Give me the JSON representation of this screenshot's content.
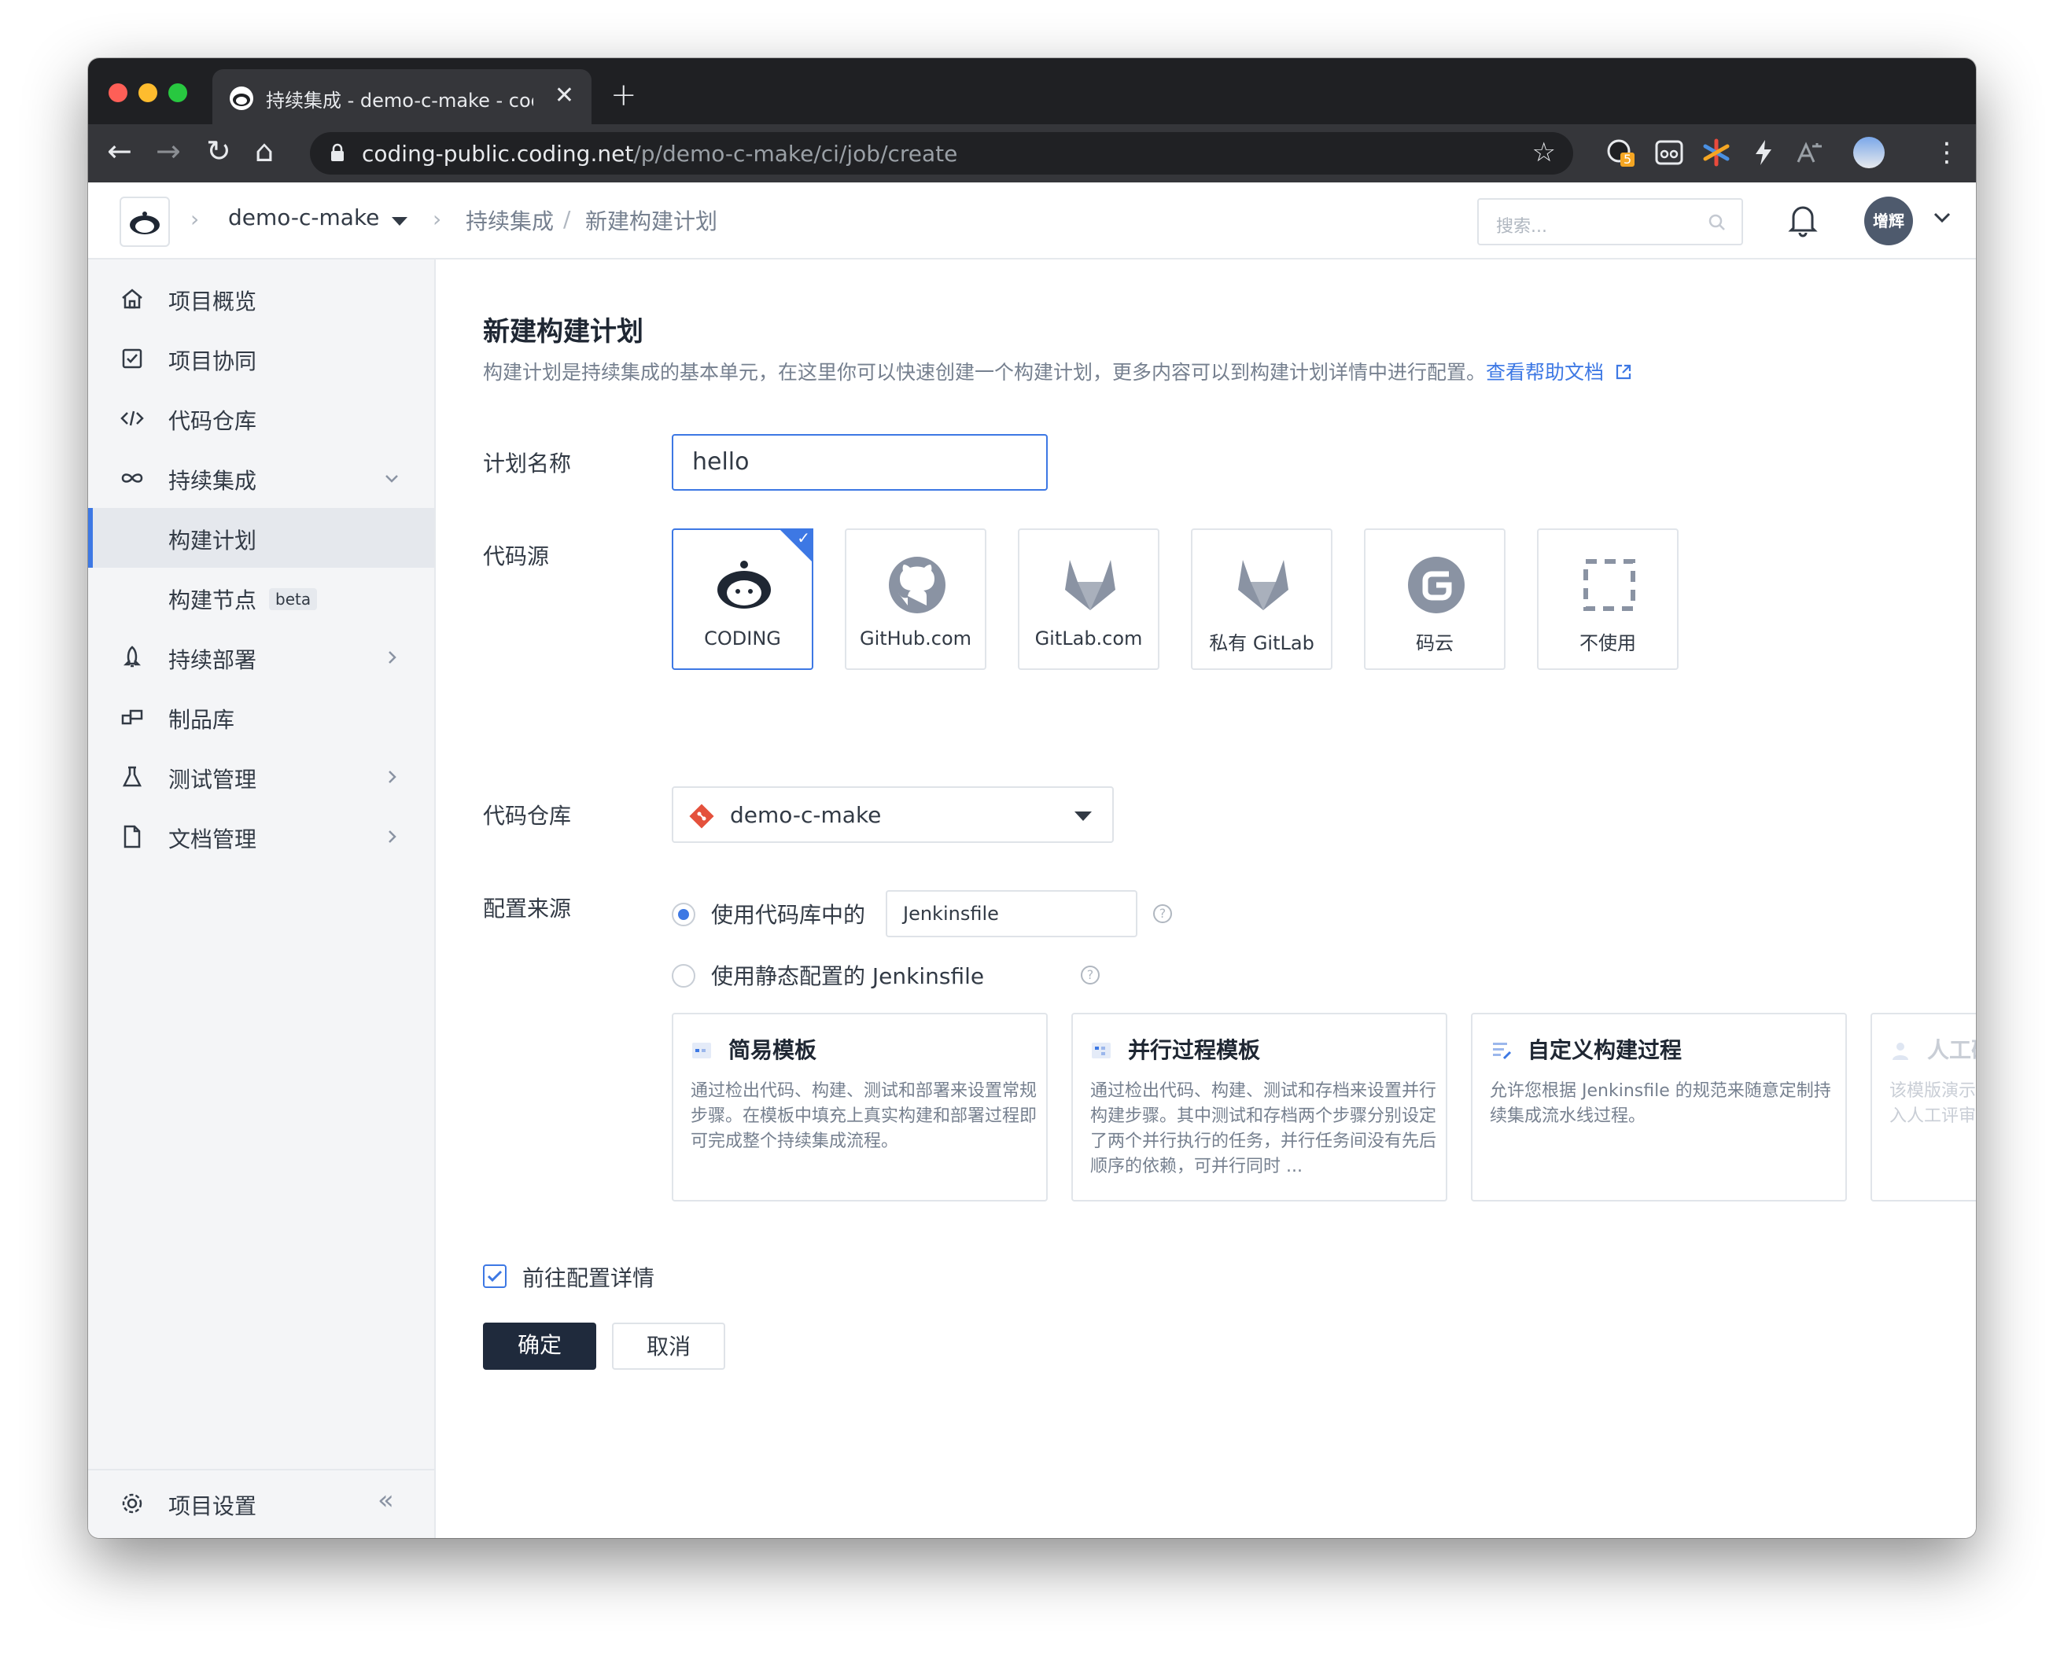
{
  "browser": {
    "tab_title": "持续集成 - demo-c-make - coding",
    "url_host": "coding-public.coding.net",
    "url_path": "/p/demo-c-make/ci/job/create",
    "extension_badge": "5"
  },
  "header": {
    "project": "demo-c-make",
    "breadcrumb_section": "持续集成",
    "breadcrumb_page": "新建构建计划",
    "search_placeholder": "搜索...",
    "avatar_text": "增辉"
  },
  "sidebar": {
    "items": [
      {
        "label": "项目概览",
        "icon": "home-icon"
      },
      {
        "label": "项目协同",
        "icon": "checkbox-icon"
      },
      {
        "label": "代码仓库",
        "icon": "code-icon"
      },
      {
        "label": "持续集成",
        "icon": "infinity-icon"
      },
      {
        "label": "构建计划"
      },
      {
        "label": "构建节点",
        "badge": "beta"
      },
      {
        "label": "持续部署",
        "icon": "rocket-icon"
      },
      {
        "label": "制品库",
        "icon": "package-icon"
      },
      {
        "label": "测试管理",
        "icon": "flask-icon"
      },
      {
        "label": "文档管理",
        "icon": "document-icon"
      }
    ],
    "footer_label": "项目设置"
  },
  "page": {
    "title": "新建构建计划",
    "description": "构建计划是持续集成的基本单元，在这里你可以快速创建一个构建计划，更多内容可以到构建计划详情中进行配置。",
    "help_link": "查看帮助文档",
    "name_label": "计划名称",
    "name_value": "hello",
    "source_label": "代码源",
    "sources": [
      {
        "label": "CODING",
        "selected": true
      },
      {
        "label": "GitHub.com"
      },
      {
        "label": "GitLab.com"
      },
      {
        "label": "私有 GitLab"
      },
      {
        "label": "码云"
      },
      {
        "label": "不使用"
      }
    ],
    "repo_label": "代码仓库",
    "repo_value": "demo-c-make",
    "config_label": "配置来源",
    "config_option_1": "使用代码库中的",
    "jenkinsfile_value": "Jenkinsfile",
    "config_option_2": "使用静态配置的 Jenkinsfile",
    "templates": [
      {
        "title": "简易模板",
        "desc": "通过检出代码、构建、测试和部署来设置常规步骤。在模板中填充上真实构建和部署过程即可完成整个持续集成流程。"
      },
      {
        "title": "并行过程模板",
        "desc": "通过检出代码、构建、测试和存档来设置并行构建步骤。其中测试和存档两个步骤分别设定了两个并行执行的任务，并行任务间没有先后顺序的依赖，可并行同时 ..."
      },
      {
        "title": "自定义构建过程",
        "desc": "允许您根据 Jenkinsfile 的规范来随意定制持续集成流水线过程。"
      },
      {
        "title": "人工确",
        "desc": "该模版演示入人工评审"
      }
    ],
    "goto_config_label": "前往配置详情",
    "confirm_label": "确定",
    "cancel_label": "取消"
  },
  "colors": {
    "accent": "#3d78e4",
    "primary_button": "#1f2a3c",
    "gitlab_gray": "#8a93a3"
  }
}
